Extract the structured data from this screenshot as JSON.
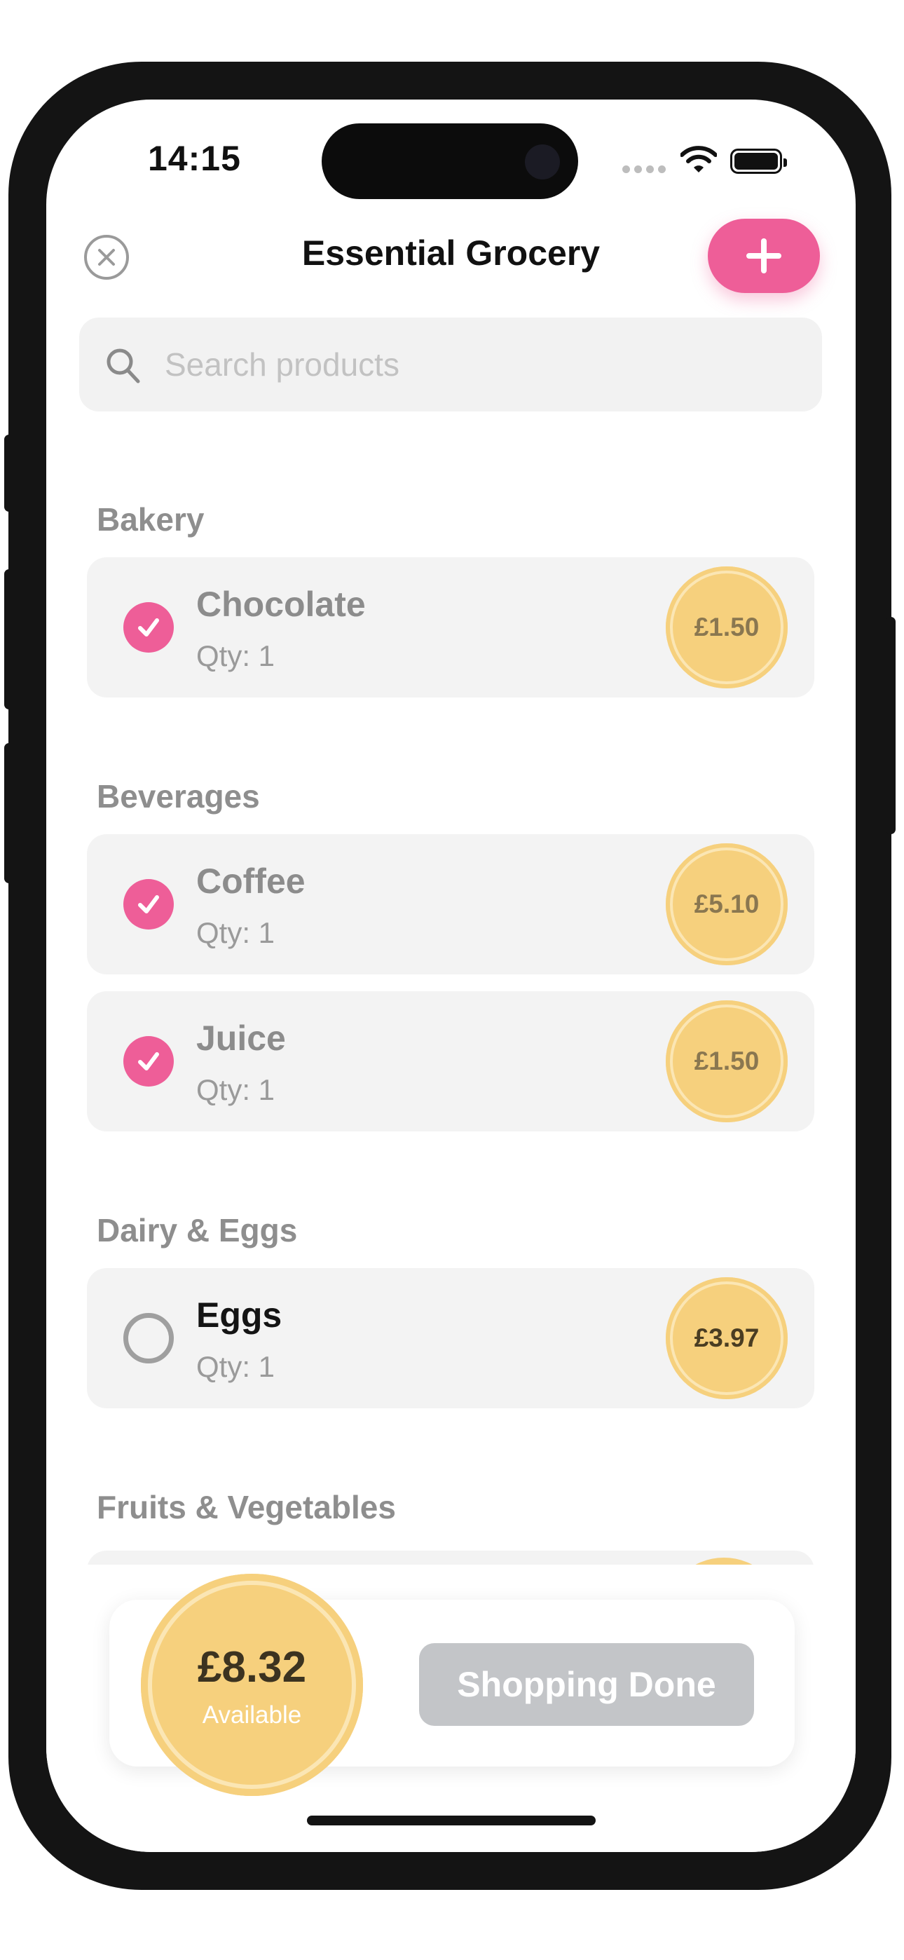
{
  "status_bar": {
    "time": "14:15"
  },
  "header": {
    "title": "Essential Grocery"
  },
  "search": {
    "placeholder": "Search products"
  },
  "sections": [
    {
      "title": "Bakery",
      "items": [
        {
          "name": "Chocolate",
          "qty": "Qty: 1",
          "price": "£1.50",
          "checked": true
        }
      ]
    },
    {
      "title": "Beverages",
      "items": [
        {
          "name": "Coffee",
          "qty": "Qty: 1",
          "price": "£5.10",
          "checked": true
        },
        {
          "name": "Juice",
          "qty": "Qty: 1",
          "price": "£1.50",
          "checked": true
        }
      ]
    },
    {
      "title": "Dairy & Eggs",
      "items": [
        {
          "name": "Eggs",
          "qty": "Qty: 1",
          "price": "£3.97",
          "checked": false
        }
      ]
    },
    {
      "title": "Fruits & Vegetables",
      "items": []
    }
  ],
  "footer": {
    "budget_amount": "£8.32",
    "budget_label": "Available",
    "done_label": "Shopping Done"
  },
  "colors": {
    "accent_pink": "#ee5e98",
    "coin_gold": "#f6d07d",
    "disabled_gray": "#c3c5c8",
    "card_bg": "#f3f3f3"
  },
  "icons": {
    "close": "close-circle-icon",
    "add": "plus-icon",
    "search": "magnifier-icon",
    "check": "checkmark-icon"
  }
}
